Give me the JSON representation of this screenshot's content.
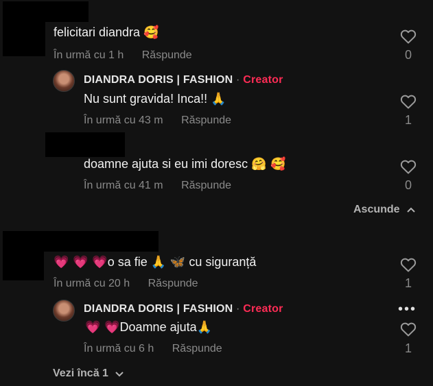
{
  "comments": [
    {
      "text": "felicitari diandra",
      "emoji": "🥰",
      "time": "În urmă cu 1 h",
      "reply_label": "Răspunde",
      "likes": "0"
    },
    {
      "author": "DIANDRA DORIS | FASHION",
      "dot": "·",
      "badge": "Creator",
      "text": "Nu sunt gravida! Inca!!",
      "emoji": "🙏",
      "time": "În urmă cu 43 m",
      "reply_label": "Răspunde",
      "likes": "1"
    },
    {
      "text": "doamne ajuta si eu imi doresc",
      "emoji": "🤗 🥰",
      "time": "În urmă cu 41 m",
      "reply_label": "Răspunde",
      "likes": "0"
    },
    {
      "emoji_pre": "💗 💗 💗",
      "text_a": "o sa fie",
      "emoji_mid": "🙏 🦋",
      "text_b": "cu siguranță",
      "time": "În urmă cu 20 h",
      "reply_label": "Răspunde",
      "likes": "1"
    },
    {
      "author": "DIANDRA DORIS | FASHION",
      "dot": "·",
      "badge": "Creator",
      "emoji_pre": "💗 💗",
      "text": "Doamne ajuta",
      "emoji": "🙏",
      "time": "În urmă cu 6 h",
      "reply_label": "Răspunde",
      "likes": "1"
    }
  ],
  "collapse_label": "Ascunde",
  "more_dots": "•••",
  "view_more_label": "Vezi încă 1",
  "icons": {
    "like": "heart-outline-icon",
    "collapse": "chevron-up-icon",
    "expand": "chevron-down-icon",
    "more": "more-icon"
  },
  "colors": {
    "background": "#121212",
    "creator": "#fe2c55",
    "muted": "#8a8a8a"
  }
}
